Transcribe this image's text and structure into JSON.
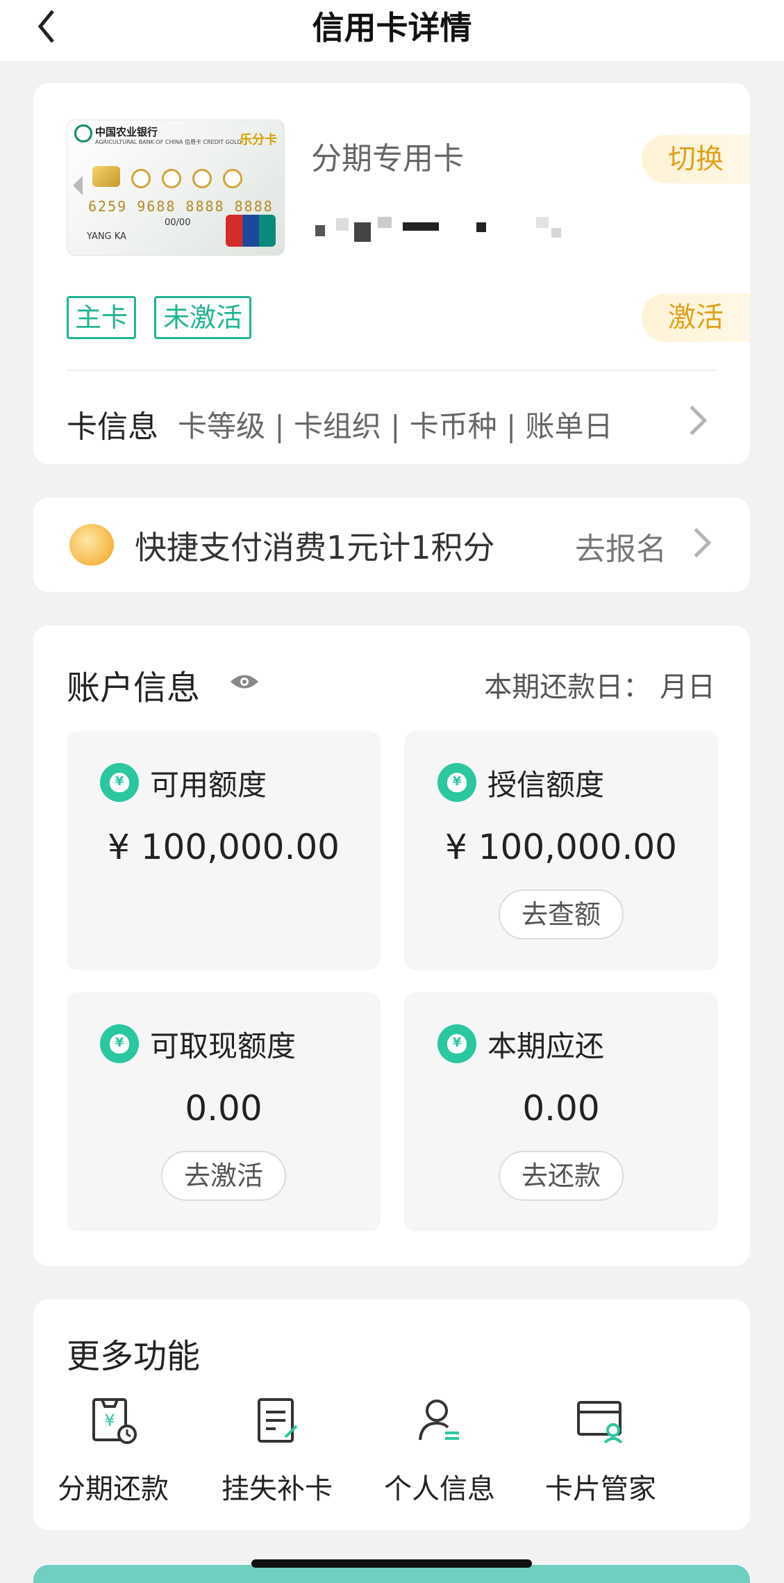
{
  "nav": {
    "title": "信用卡详情"
  },
  "card": {
    "image": {
      "bank_name": "中国农业银行",
      "bank_sub": "AGRICULTURAL BANK OF CHINA 信用卡 CREDIT GOLD",
      "brand": "乐分卡",
      "number": "6259 9688 8888 8888",
      "holder": "YANG KA",
      "valid": "00/00"
    },
    "type": "分期专用卡",
    "switch_label": "切换",
    "activate_label": "激活",
    "tags": [
      "主卡",
      "未激活"
    ],
    "info_label": "卡信息",
    "info_items": "卡等级 | 卡组织 | 卡币种 | 账单日"
  },
  "promo": {
    "text": "快捷支付消费1元计1积分",
    "action": "去报名"
  },
  "account": {
    "title": "账户信息",
    "due_text": "本期还款日： 月日",
    "tiles": [
      {
        "label": "可用额度",
        "value": "¥ 100,000.00",
        "button": ""
      },
      {
        "label": "授信额度",
        "value": "¥ 100,000.00",
        "button": "去查额"
      },
      {
        "label": "可取现额度",
        "value": "0.00",
        "button": "去激活"
      },
      {
        "label": "本期应还",
        "value": "0.00",
        "button": "去还款"
      }
    ]
  },
  "more": {
    "title": "更多功能",
    "items": [
      {
        "label": "分期还款",
        "icon": "installment-repay-icon"
      },
      {
        "label": "挂失补卡",
        "icon": "report-loss-icon"
      },
      {
        "label": "个人信息",
        "icon": "personal-info-icon"
      },
      {
        "label": "卡片管家",
        "icon": "card-manager-icon"
      }
    ]
  },
  "colors": {
    "accent": "#2bc7a0",
    "tag": "#1fb494",
    "gold": "#e0a21a"
  }
}
